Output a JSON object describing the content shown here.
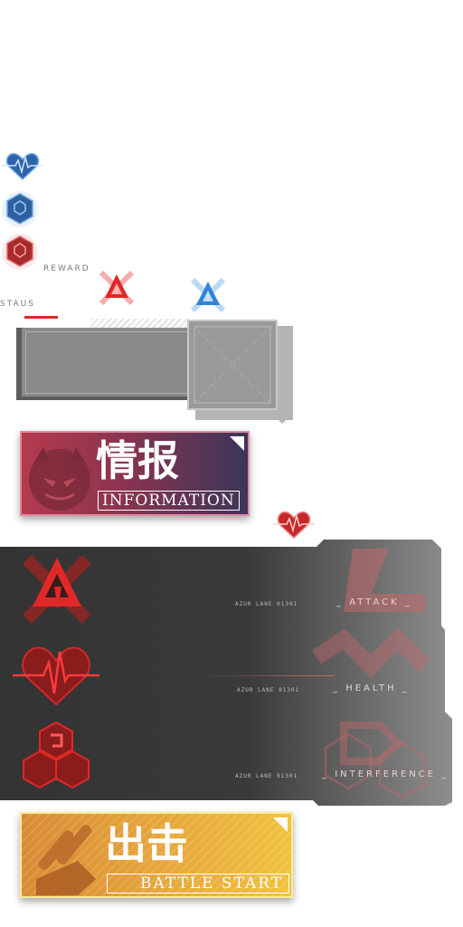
{
  "labels": {
    "reward": "REWARD",
    "status": "STAUS"
  },
  "info_card": {
    "title_cn": "情报",
    "title_en": "INFORMATION"
  },
  "stat_rows": [
    {
      "code": "AZUR LANE 01301",
      "label": "ATTACK",
      "icon": "attack-emblem-icon"
    },
    {
      "code": "AZUR LANE 01301",
      "label": "HEALTH",
      "icon": "heartbeat-icon"
    },
    {
      "code": "AZUR LANE 01301",
      "label": "INTERFERENCE",
      "icon": "hexagon-cluster-icon"
    }
  ],
  "battle_card": {
    "title_cn": "出击",
    "title_en": "BATTLE START"
  },
  "colors": {
    "red_accent": "#e2252b",
    "blue_accent": "#3a8fe0",
    "info_gradient_start": "#b53a4d",
    "info_gradient_end": "#3b3558",
    "battle_gradient_start": "#d98b35",
    "battle_gradient_end": "#f0c23f",
    "dark_panel": "#323232"
  }
}
